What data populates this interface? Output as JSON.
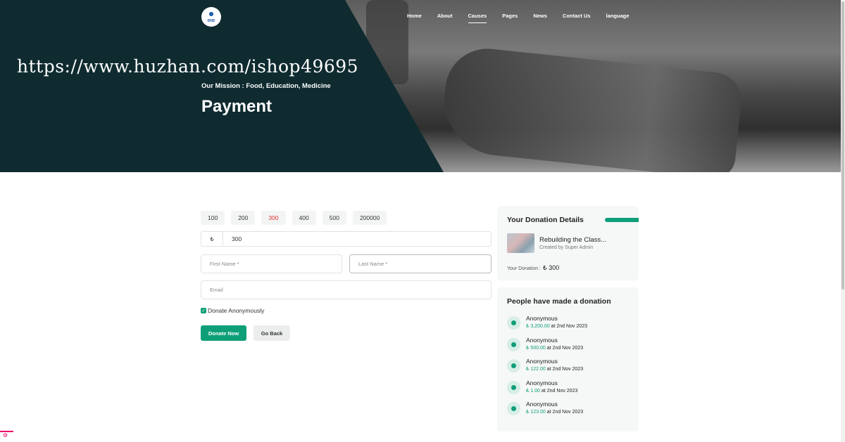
{
  "header": {
    "logo_text": "DND",
    "nav": [
      "Home",
      "About",
      "Causes",
      "Pages",
      "News",
      "Contact Us",
      "language"
    ],
    "active_nav": "Causes"
  },
  "hero": {
    "watermark": "https://www.huzhan.com/ishop49695",
    "mission": "Our Mission : Food, Education, Medicine",
    "title": "Payment"
  },
  "form": {
    "amounts": [
      "100",
      "200",
      "300",
      "400",
      "500",
      "200000"
    ],
    "selected_amount": "300",
    "currency_symbol": "₺",
    "amount_value": "300",
    "first_name_placeholder": "First Name *",
    "last_name_placeholder": "Last Name *",
    "email_placeholder": "Email",
    "anonymous_label": "Donate Anonymously",
    "anonymous_checked": true,
    "donate_label": "Donate Now",
    "back_label": "Go Back"
  },
  "details": {
    "heading": "Your Donation Details",
    "cause_title": "Rebuilding the Class...",
    "cause_creator": "Created by Super Admin",
    "your_donation_label": "Your Donation :",
    "your_donation_amount": "₺ 300"
  },
  "donors": {
    "heading": "People have made a donation",
    "items": [
      {
        "name": "Anonymous",
        "amount": "₺ 3,200.00",
        "date": "at 2nd Nov 2023"
      },
      {
        "name": "Anonymous",
        "amount": "₺ 500.00",
        "date": "at 2nd Nov 2023"
      },
      {
        "name": "Anonymous",
        "amount": "₺ 122.00",
        "date": "at 2nd Nov 2023"
      },
      {
        "name": "Anonymous",
        "amount": "₺ 1.00",
        "date": "at 2nd Nov 2023"
      },
      {
        "name": "Anonymous",
        "amount": "₺ 123.00",
        "date": "at 2nd Nov 2023"
      }
    ]
  },
  "colors": {
    "accent": "#0e9f79",
    "hero_dark": "#0f2b30",
    "selected": "#dd3333"
  }
}
